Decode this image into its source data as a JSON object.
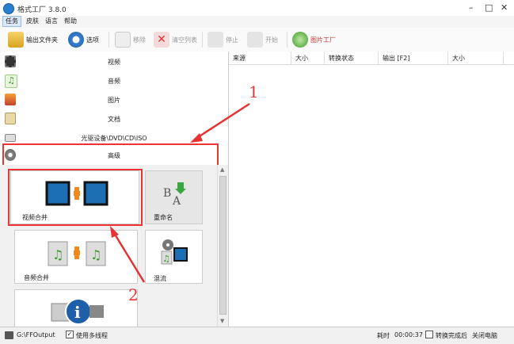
{
  "window": {
    "title": "格式工厂 3.8.0"
  },
  "menu": [
    "任务",
    "皮肤",
    "语言",
    "帮助"
  ],
  "toolbar": {
    "output_folder": "输出文件夹",
    "options": "选项",
    "remove": "移除",
    "clear_list": "清空列表",
    "stop": "停止",
    "start": "开始",
    "picture_factory": "图片工厂"
  },
  "sidebar": {
    "categories": [
      "视频",
      "音频",
      "图片",
      "文档",
      "光驱设备\\DVD\\CD\\ISO",
      "高级"
    ],
    "tiles": [
      "视频合并",
      "重命名",
      "音频合并",
      "混流"
    ]
  },
  "table": {
    "headers": [
      "来源",
      "大小",
      "转换状态",
      "输出 [F2]",
      "大小"
    ]
  },
  "status": {
    "output_path": "G:\\FFOutput",
    "multithread": "使用多线程",
    "elapsed_label": "耗时",
    "elapsed": "00:00:37",
    "after_done": "转换完成后",
    "shutdown": "关闭电脑"
  },
  "annotations": [
    "1",
    "2"
  ],
  "colors": {
    "annotation": "#e33333"
  }
}
